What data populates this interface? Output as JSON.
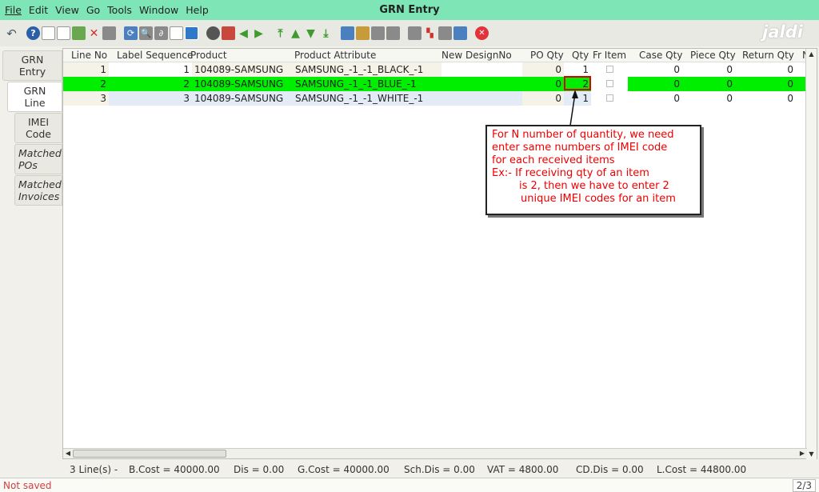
{
  "menubar": {
    "items": [
      "File",
      "Edit",
      "View",
      "Go",
      "Tools",
      "Window",
      "Help"
    ],
    "title": "GRN Entry"
  },
  "logo": "jaldi",
  "left_tabs": [
    {
      "line1": "GRN",
      "line2": "Entry"
    },
    {
      "line1": "GRN",
      "line2": "Line"
    },
    {
      "line1": "IMEI",
      "line2": "Code"
    },
    {
      "line1": "Matched",
      "line2": "POs"
    },
    {
      "line1": "Matched",
      "line2": "Invoices"
    }
  ],
  "grid": {
    "headers": [
      "Line No",
      "Label Sequence",
      "Product",
      "Product Attribute",
      "New DesignNo",
      "PO Qty",
      "Qty",
      "Fr Item",
      "Case Qty",
      "Piece Qty",
      "Return Qty",
      "N"
    ],
    "rows": [
      {
        "line_no": "1",
        "label_seq": "1",
        "product": "104089-SAMSUNG",
        "attribute": "SAMSUNG_-1_-1_BLACK_-1",
        "po_qty": "0",
        "qty": "1",
        "case_qty": "0",
        "piece_qty": "0",
        "return_qty": "0"
      },
      {
        "line_no": "2",
        "label_seq": "2",
        "product": "104089-SAMSUNG",
        "attribute": "SAMSUNG_-1_-1_BLUE_-1",
        "po_qty": "0",
        "qty": "2",
        "case_qty": "0",
        "piece_qty": "0",
        "return_qty": "0"
      },
      {
        "line_no": "3",
        "label_seq": "3",
        "product": "104089-SAMSUNG",
        "attribute": "SAMSUNG_-1_-1_WHITE_-1",
        "po_qty": "0",
        "qty": "1",
        "case_qty": "0",
        "piece_qty": "0",
        "return_qty": "0"
      }
    ]
  },
  "callout": {
    "lines": [
      "For N number of quantity, we need",
      "enter same numbers of IMEI code",
      "for each received items",
      "Ex:- If receiving qty of an item",
      "is 2, then we have to enter 2",
      "unique IMEI codes for an item"
    ]
  },
  "totals": {
    "lines": "3 Line(s) -",
    "b_cost": "B.Cost = 40000.00",
    "dis": "Dis = 0.00",
    "g_cost": "G.Cost = 40000.00",
    "sch_dis": "Sch.Dis = 0.00",
    "vat": "VAT = 4800.00",
    "cd_dis": "CD.Dis = 0.00",
    "l_cost": "L.Cost = 44800.00"
  },
  "status": {
    "text": "Not saved",
    "page": "2/3"
  }
}
